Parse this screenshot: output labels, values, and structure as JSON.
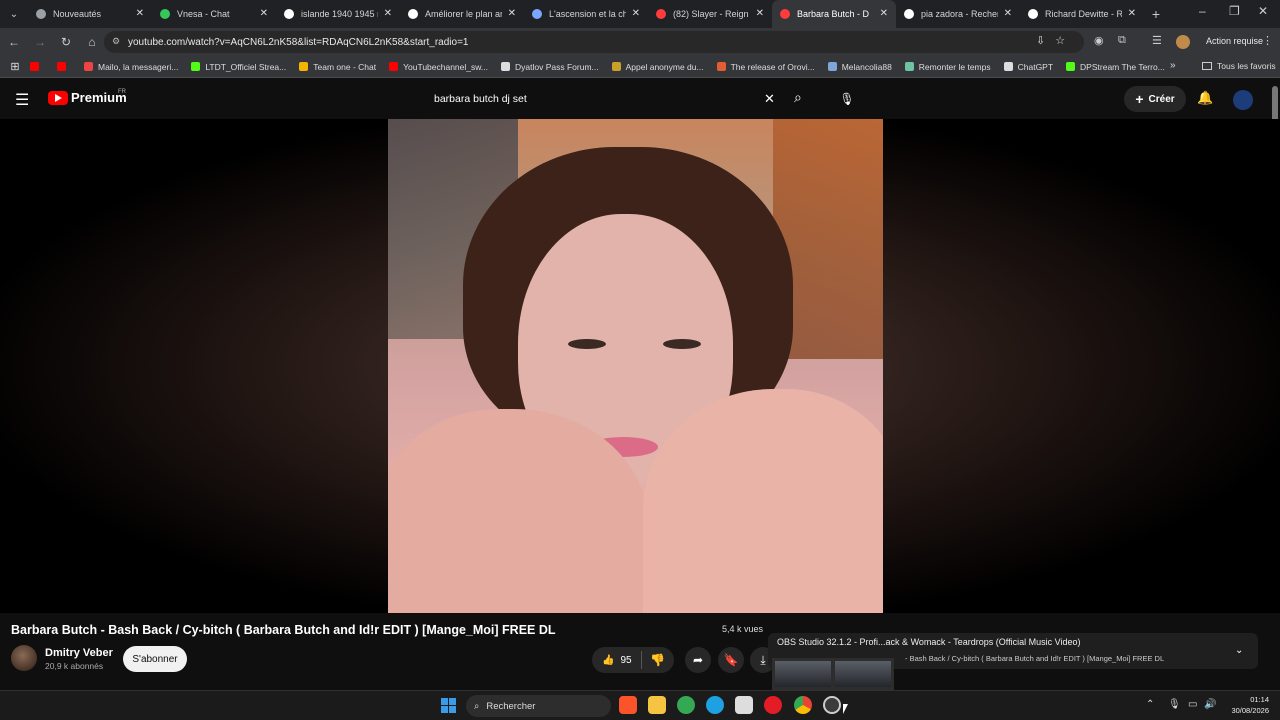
{
  "browser": {
    "tabs": [
      {
        "label": "Nouveautés",
        "color": "#9aa0a6"
      },
      {
        "label": "Vnesa - Chat",
        "color": "#34c759"
      },
      {
        "label": "islande 1940 1945 m",
        "color": "#ffffff"
      },
      {
        "label": "Améliorer le plan arc",
        "color": "#ffffff"
      },
      {
        "label": "L'ascension et la chut",
        "color": "#7aa7ff"
      },
      {
        "label": "(82) Slayer - Reign In",
        "color": "#ff3b3b"
      },
      {
        "label": "Barbara Butch - D",
        "color": "#ff3b3b",
        "active": true
      },
      {
        "label": "pia zadora - Recherc",
        "color": "#ffffff"
      },
      {
        "label": "Richard Dewitte - Re",
        "color": "#ffffff"
      }
    ],
    "url": "youtube.com/watch?v=AqCN6L2nK58&list=RDAqCN6L2nK58&start_radio=1",
    "action_label": "Action requise",
    "bookmarks": [
      {
        "label": "",
        "color": "#ff0000"
      },
      {
        "label": "",
        "color": "#ff0000"
      },
      {
        "label": "Mailo, la messageri...",
        "color": "#e44"
      },
      {
        "label": "LTDT_Officiel Strea...",
        "color": "#53fc18"
      },
      {
        "label": "Team one - Chat",
        "color": "#f5b400"
      },
      {
        "label": "YouTubechannel_sw...",
        "color": "#ff0000"
      },
      {
        "label": "Dyatlov Pass Forum...",
        "color": "#dddddd"
      },
      {
        "label": "Appel anonyme du...",
        "color": "#c9a227"
      },
      {
        "label": "The release of Orovi...",
        "color": "#e35d33"
      },
      {
        "label": "Melancolia88",
        "color": "#7ea6d8"
      },
      {
        "label": "Remonter le temps",
        "color": "#6cc4a1"
      },
      {
        "label": "ChatGPT",
        "color": "#dddddd"
      },
      {
        "label": "DPStream The Terro...",
        "color": "#53fc18"
      }
    ],
    "all_favorites": "Tous les favoris"
  },
  "youtube": {
    "logo_text": "Premium",
    "logo_region": "FR",
    "search_value": "barbara butch dj set",
    "create_label": "Créer",
    "video_title": "Barbara Butch - Bash Back / Cy-bitch ( Barbara Butch and Id!r EDIT ) [Mange_Moi] FREE DL",
    "views": "5,4 k vues",
    "channel_name": "Dmitry Veber",
    "subscribers": "20,9 k abonnés",
    "subscribe_label": "S'abonner",
    "likes": "95"
  },
  "popup": {
    "line1": "OBS Studio 32.1.2 - Profi...ack & Womack - Teardrops (Official Music Video)",
    "line2": "- Bash Back / Cy-bitch ( Barbara Butch and Id!r EDIT ) [Mange_Moi] FREE DL"
  },
  "taskbar": {
    "search_label": "Rechercher",
    "time": "01:14",
    "date": "30/08/2026"
  }
}
